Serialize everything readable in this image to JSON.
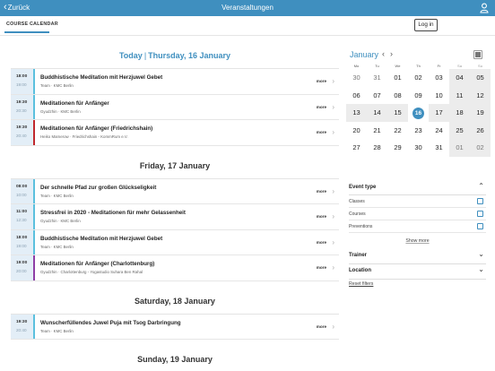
{
  "topbar": {
    "back_label": "Zurück",
    "title": "Veranstaltungen",
    "user_icon": "user-icon"
  },
  "subbar": {
    "tab_label": "COURSE CALENDAR",
    "login_label": "Log in"
  },
  "days": [
    {
      "today_label": "Today",
      "separator": "|",
      "date_label": "Thursday, 16 January",
      "events": [
        {
          "start": "18:00",
          "end": "19:00",
          "title": "Buddhistische Meditation mit Herzjuwel Gebet",
          "sub": "Team · KMC Berlin",
          "more": "more",
          "bar": "blue"
        },
        {
          "start": "19:30",
          "end": "20:30",
          "title": "Meditationen für Anfänger",
          "sub": "Gyudzhin · KMC Berlin",
          "more": "more",
          "bar": "blue"
        },
        {
          "start": "19:30",
          "end": "20:40",
          "title": "Meditationen für Anfänger (Friedrichshain)",
          "sub": "Heiko Mamerow · Friedrichshain - KommRum e.V.",
          "more": "more",
          "bar": "red"
        }
      ]
    },
    {
      "date_label": "Friday, 17 January",
      "events": [
        {
          "start": "08:00",
          "end": "10:00",
          "title": "Der schnelle Pfad zur großen Glückseligkeit",
          "sub": "Team · KMC Berlin",
          "more": "more",
          "bar": "blue"
        },
        {
          "start": "11:00",
          "end": "12:30",
          "title": "Stressfrei in 2020 - Meditationen für mehr Gelassenheit",
          "sub": "Gyudzhin · KMC Berlin",
          "more": "more",
          "bar": "blue"
        },
        {
          "start": "18:00",
          "end": "19:00",
          "title": "Buddhistische Meditation mit Herzjuwel Gebet",
          "sub": "Team · KMC Berlin",
          "more": "more",
          "bar": "blue"
        },
        {
          "start": "19:00",
          "end": "20:00",
          "title": "Meditationen für Anfänger (Charlottenburg)",
          "sub": "Gyudzhin · Charlottenburg - Yogastudio Suhara Ben Rahal",
          "more": "more",
          "bar": "purple"
        }
      ]
    },
    {
      "date_label": "Saturday, 18 January",
      "events": [
        {
          "start": "19:30",
          "end": "20:40",
          "title": "Wunscherfüllendes Juwel Puja mit Tsog Darbringung",
          "sub": "Team · KMC Berlin",
          "more": "more",
          "bar": "blue"
        }
      ]
    },
    {
      "date_label": "Sunday, 19 January",
      "events": []
    }
  ],
  "calendar": {
    "month": "January",
    "prev": "‹",
    "next": "›",
    "weekdays": [
      "Mo",
      "Tu",
      "We",
      "Th",
      "Fr",
      "Sa",
      "Su"
    ],
    "weeks": [
      [
        "30",
        "31",
        "01",
        "02",
        "03",
        "04",
        "05"
      ],
      [
        "06",
        "07",
        "08",
        "09",
        "10",
        "11",
        "12"
      ],
      [
        "13",
        "14",
        "15",
        "16",
        "17",
        "18",
        "19"
      ],
      [
        "20",
        "21",
        "22",
        "23",
        "24",
        "25",
        "26"
      ],
      [
        "27",
        "28",
        "29",
        "30",
        "31",
        "01",
        "02"
      ]
    ],
    "today": "16"
  },
  "filters": {
    "event_type_label": "Event type",
    "options": [
      "Classes",
      "Courses",
      "Preventions"
    ],
    "show_more": "Show more",
    "trainer_label": "Trainer",
    "location_label": "Location",
    "reset_label": "Reset filters"
  },
  "colors": {
    "accent": "#3f8fbf",
    "bar_blue": "#5bc0de",
    "bar_red": "#c0282d",
    "bar_purple": "#8e3fa6"
  }
}
